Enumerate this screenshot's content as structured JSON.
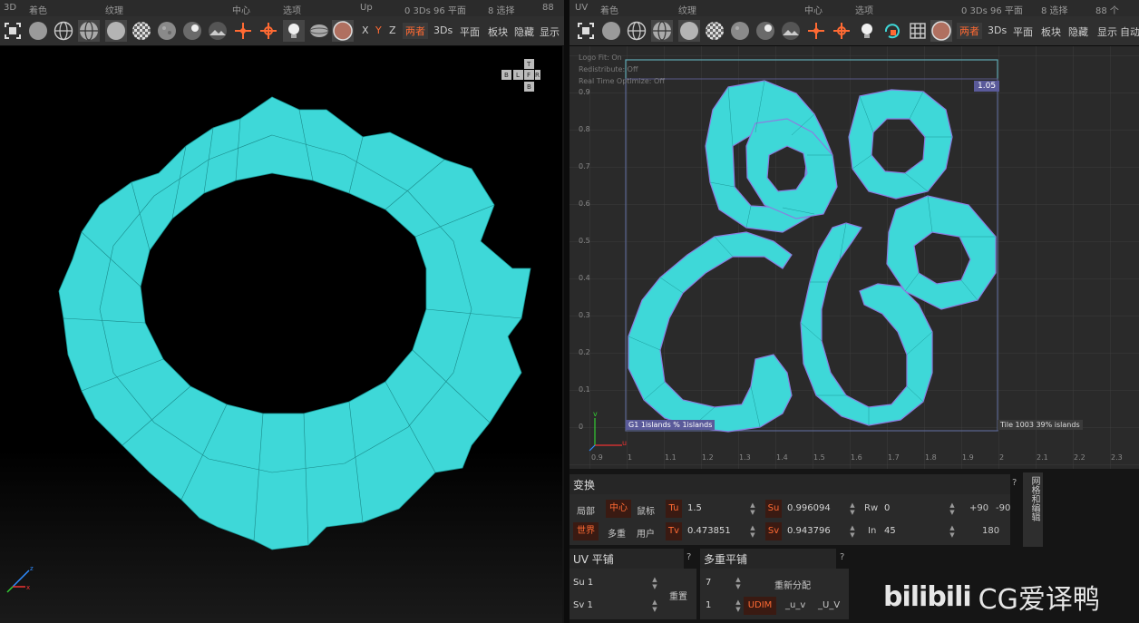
{
  "left": {
    "menu": [
      "3D",
      "着色",
      "纹理",
      "中心",
      "选项",
      "Up",
      "0 3Ds 96 平面",
      "8 选择",
      "88"
    ],
    "toolbar": {
      "x": "X",
      "y": "Y",
      "z": "Z",
      "both": "两者",
      "threeds": "3Ds",
      "plane": "平面",
      "block": "板块",
      "hide": "隐藏",
      "show": "显示"
    },
    "nav_cube": {
      "t": "T",
      "b": "B",
      "l": "L",
      "f": "F",
      "r": "R",
      "b2": "B"
    },
    "axis": {
      "z": "z",
      "x": "x",
      "y": "y"
    }
  },
  "right": {
    "menu": [
      "UV",
      "着色",
      "纹理",
      "中心",
      "选项",
      "0 3Ds 96 平面",
      "8 选择",
      "88 个"
    ],
    "toolbar": {
      "both": "两者",
      "threeds": "3Ds",
      "plane": "平面",
      "block": "板块",
      "hide": "隐藏",
      "show": "显示",
      "auto": "自动"
    },
    "overlays": {
      "logo_fit": "Logo Fit: On",
      "redistribute": "Redistribute: Off",
      "realtime": "Real Time Optimize: Off"
    },
    "tile_value": "1.05",
    "tile_label_left": "G1  1islands %  1islands",
    "tile_label_right": "Tile 1003 39%  islands",
    "y_ticks": [
      "0.9",
      "0.8",
      "0.7",
      "0.6",
      "0.5",
      "0.4",
      "0.3",
      "0.2",
      "0.1",
      "0"
    ],
    "x_ticks": [
      "0.9",
      "1",
      "1.1",
      "1.2",
      "1.3",
      "1.4",
      "1.5",
      "1.6",
      "1.7",
      "1.8",
      "1.9",
      "2",
      "2.1",
      "2.2",
      "2.3"
    ],
    "uv_axis": {
      "u": "u",
      "v": "v"
    }
  },
  "transform": {
    "title": "变换",
    "help": "?",
    "side_tab": "网格和编辑",
    "local": "局部",
    "center": "中心",
    "mouse": "鼠标",
    "world": "世界",
    "multi": "多重",
    "user": "用户",
    "tu_label": "Tu",
    "tu_value": "1.5",
    "tv_label": "Tv",
    "tv_value": "0.473851",
    "su_label": "Su",
    "su_value": "0.996094",
    "sv_label": "Sv",
    "sv_value": "0.943796",
    "rw_label": "Rw",
    "rw_value": "0",
    "in_label": "In",
    "in_value": "45",
    "plus90": "+90",
    "minus90": "-90",
    "v180": "180"
  },
  "uvtile": {
    "title": "UV 平铺",
    "help": "?",
    "su": "Su 1",
    "sv": "Sv 1",
    "reset": "重置"
  },
  "multitile": {
    "title": "多重平铺",
    "help": "?",
    "count": "7",
    "redistribute": "重新分配",
    "one": "1",
    "udim": "UDIM",
    "uv1": "_u_v",
    "uv2": "_U_V"
  },
  "watermark": {
    "bili": "bilibili",
    "brand": "CG爱译鸭"
  },
  "colors": {
    "accent": "#ff6a33",
    "mesh": "#3ed8d8",
    "tile_border": "#5fa8b4"
  }
}
